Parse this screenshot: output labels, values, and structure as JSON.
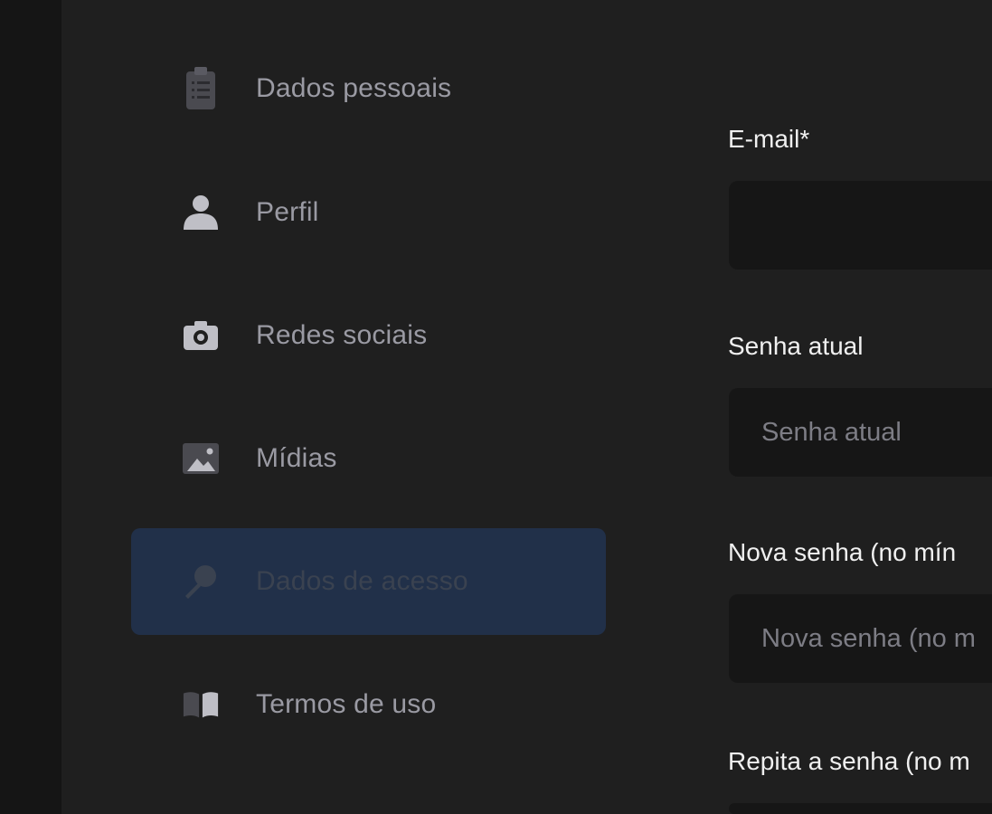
{
  "sidebar": {
    "items": [
      {
        "label": "Dados pessoais",
        "icon": "clipboard-icon",
        "active": false
      },
      {
        "label": "Perfil",
        "icon": "person-icon",
        "active": false
      },
      {
        "label": "Redes sociais",
        "icon": "camera-icon",
        "active": false
      },
      {
        "label": "Mídias",
        "icon": "image-icon",
        "active": false
      },
      {
        "label": "Dados de acesso",
        "icon": "key-icon",
        "active": true
      },
      {
        "label": "Termos de uso",
        "icon": "book-icon",
        "active": false
      }
    ]
  },
  "form": {
    "email": {
      "label": "E-mail*",
      "value": "",
      "placeholder": ""
    },
    "current_password": {
      "label": "Senha atual",
      "placeholder": "Senha atual"
    },
    "new_password": {
      "label": "Nova senha (no mín",
      "placeholder": "Nova senha (no m"
    },
    "repeat_password": {
      "label": "Repita a senha (no m"
    }
  },
  "colors": {
    "background": "#1f1f1f",
    "active_item_bg": "#213049",
    "input_bg": "#161616",
    "muted_text": "#9a9aa3"
  }
}
